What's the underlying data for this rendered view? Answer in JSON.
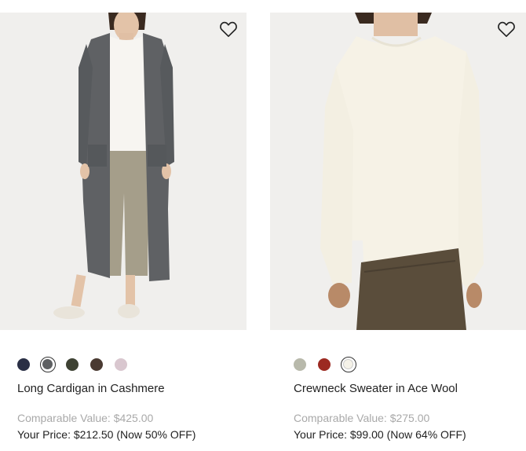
{
  "products": [
    {
      "name": "Long Cardigan in Cashmere",
      "comparable_label": "Comparable Value: $425.00",
      "price_label": "Your Price: $212.50 (Now 50% OFF)",
      "wishlist_icon": "heart-outline-icon",
      "image_colors": {
        "background": "#f0efed",
        "cardigan": "#5f6164",
        "top": "#f7f5f1",
        "pants": "#a59e8a"
      },
      "swatches": [
        {
          "color": "#2a2f45",
          "selected": false
        },
        {
          "color": "#5e6062",
          "selected": true
        },
        {
          "color": "#3e4233",
          "selected": false
        },
        {
          "color": "#4a3a32",
          "selected": false
        },
        {
          "color": "#d9c7cf",
          "selected": false
        }
      ]
    },
    {
      "name": "Crewneck Sweater in Ace Wool",
      "comparable_label": "Comparable Value: $275.00",
      "price_label": "Your Price: $99.00 (Now 64% OFF)",
      "wishlist_icon": "heart-outline-icon",
      "image_colors": {
        "background": "#f0efed",
        "sweater": "#f6f2e6",
        "pants": "#5a4d3b"
      },
      "swatches": [
        {
          "color": "#b8b9ab",
          "selected": false
        },
        {
          "color": "#9c2a22",
          "selected": false
        },
        {
          "color": "#f5f2e8",
          "selected": true
        }
      ]
    }
  ]
}
